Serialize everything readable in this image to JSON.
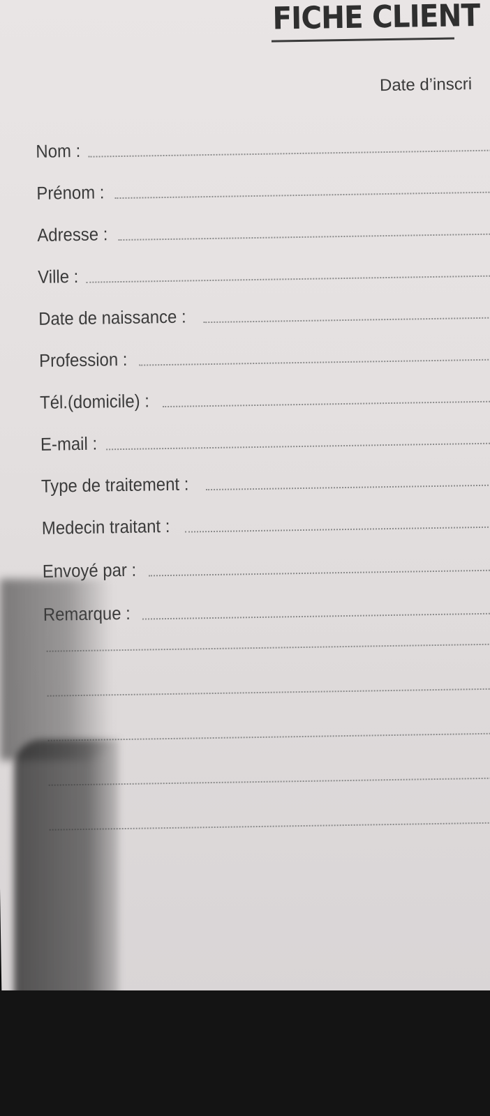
{
  "document": {
    "title": "FICHE CLIENT",
    "date_label": "Date d’inscri"
  },
  "fields": [
    {
      "label": "Nom :"
    },
    {
      "label": "Prénom :"
    },
    {
      "label": "Adresse :"
    },
    {
      "label": "Ville :"
    },
    {
      "label": "Date de naissance :"
    },
    {
      "label": "Profession :"
    },
    {
      "label": "Tél.(domicile) :"
    },
    {
      "label": "E-mail :"
    },
    {
      "label": "Type de traitement :"
    },
    {
      "label": "Medecin traitant :"
    },
    {
      "label": "Envoyé par :"
    },
    {
      "label": "Remarque :"
    }
  ],
  "remark_blank_lines": 5
}
